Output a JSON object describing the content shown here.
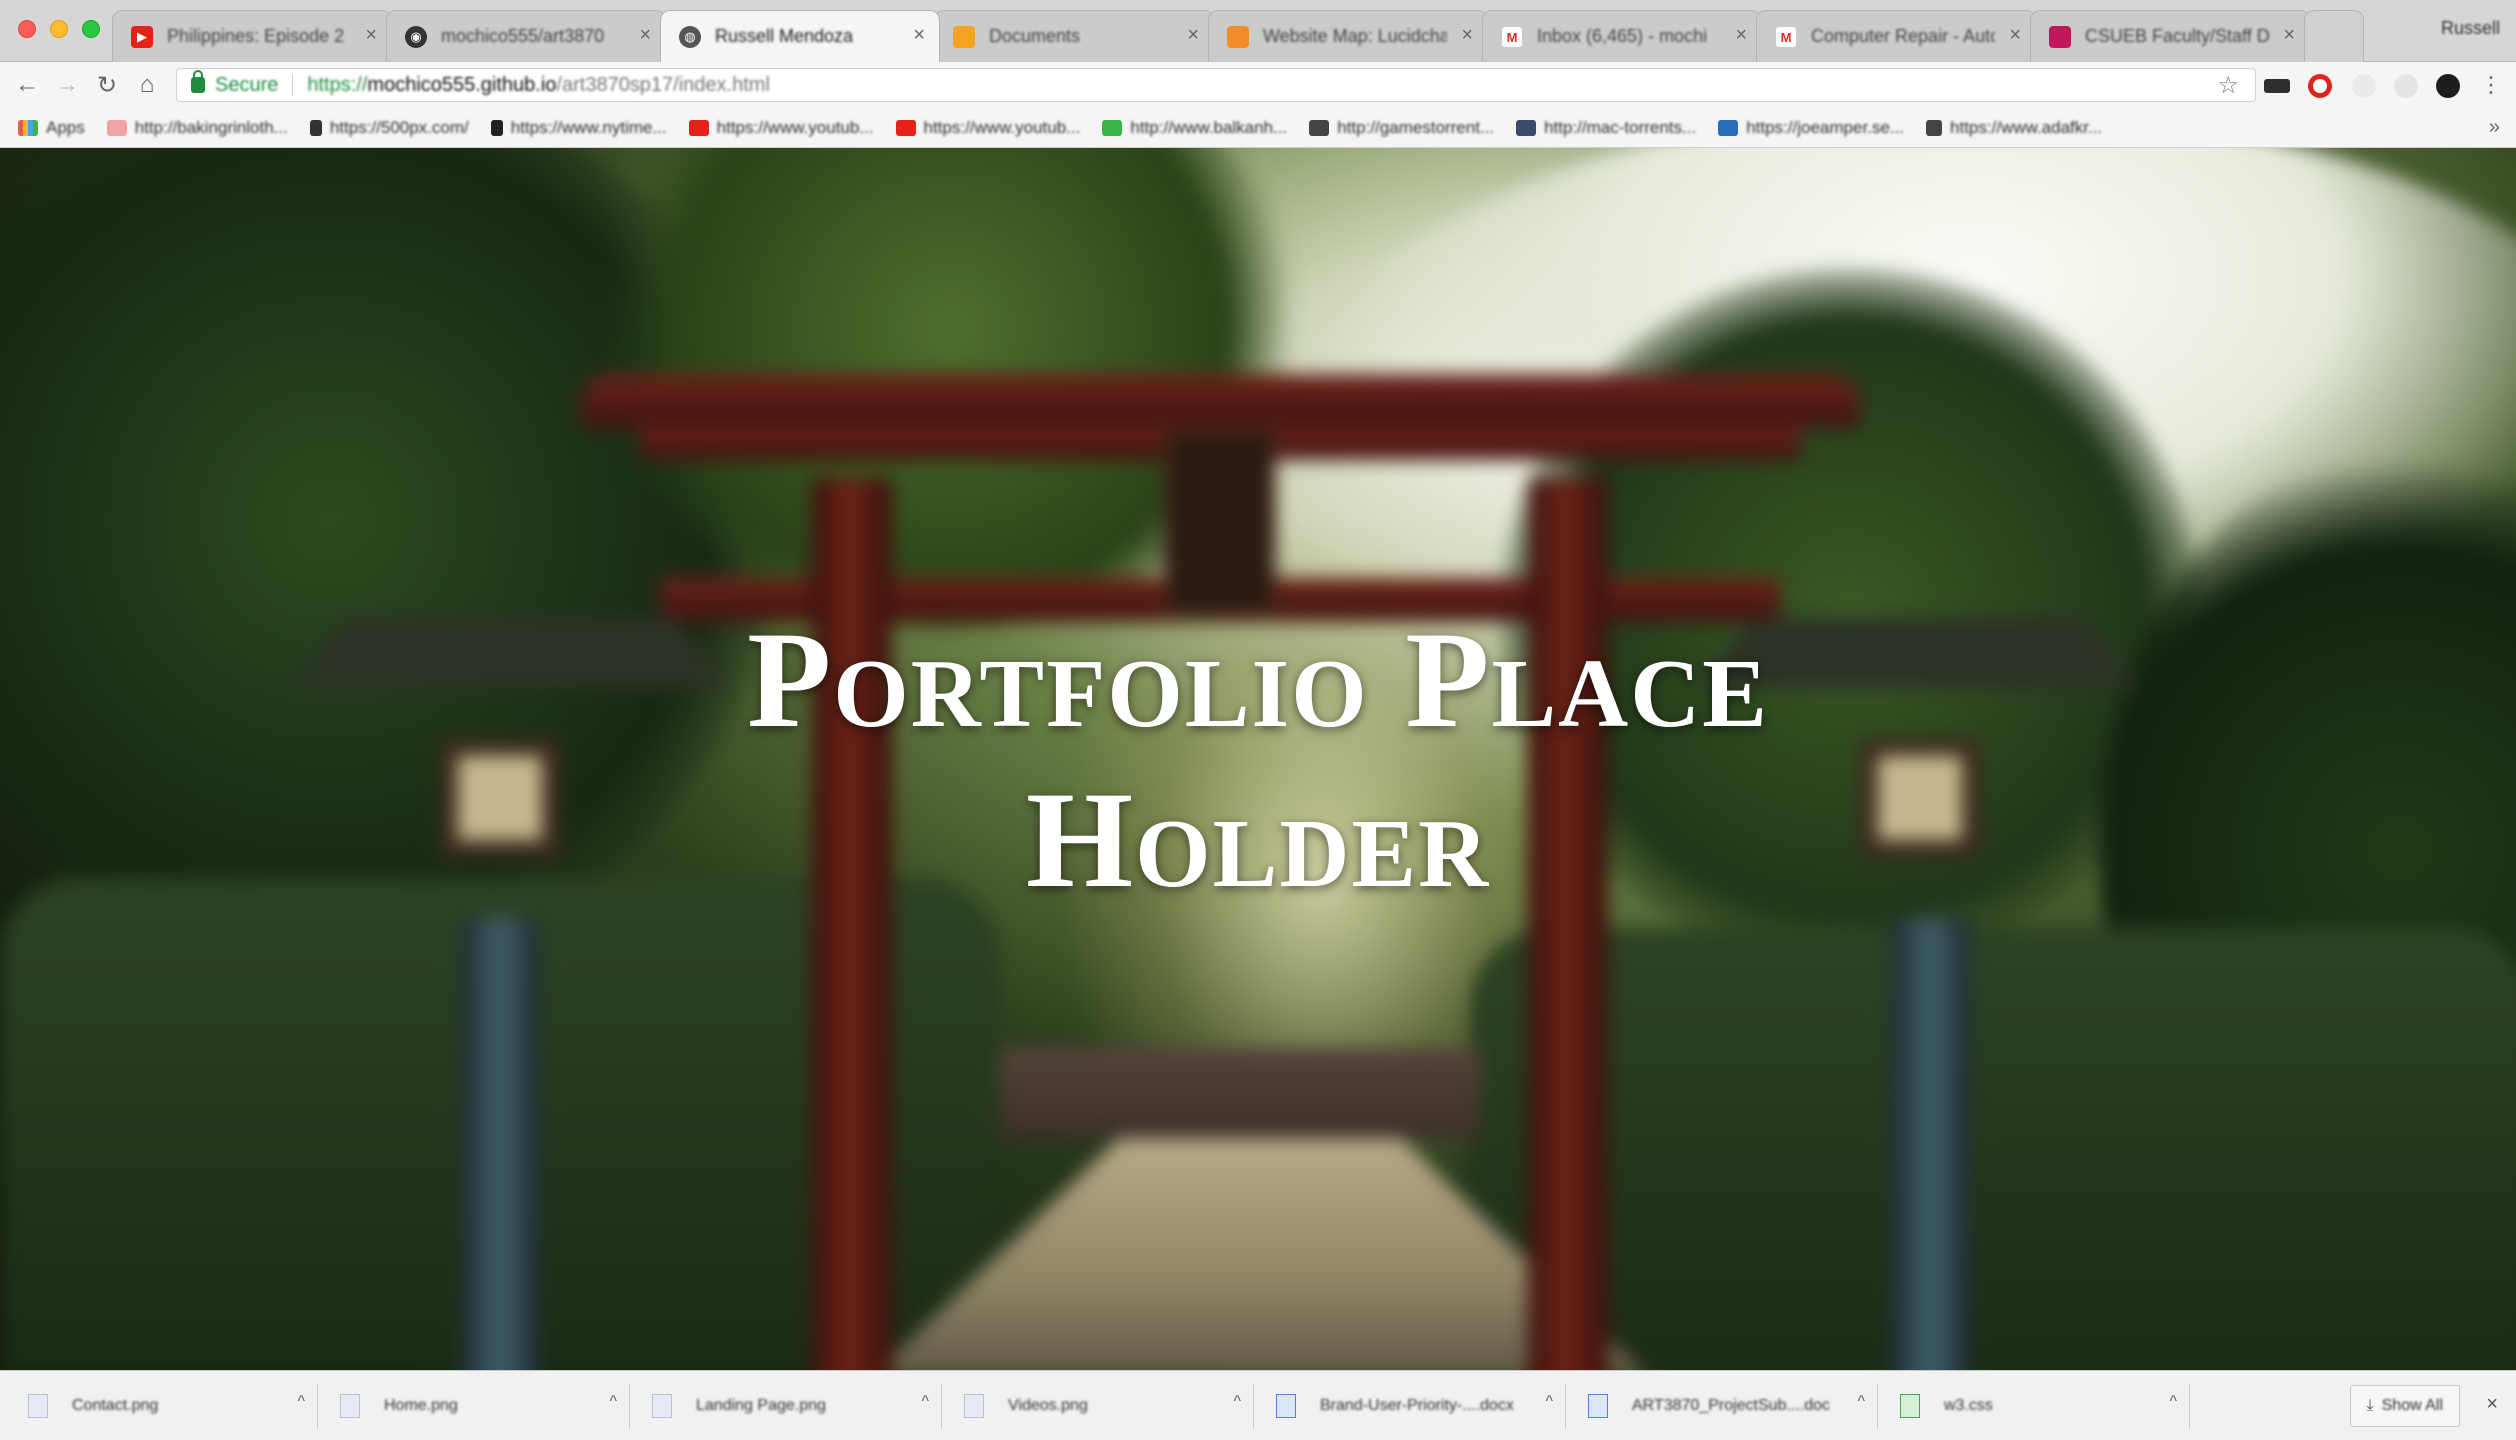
{
  "browser": {
    "tabs": [
      {
        "title": "Philippines: Episode 2",
        "favicon": "youtube-icon",
        "color": "#e62117"
      },
      {
        "title": "mochico555/art3870",
        "favicon": "github-icon",
        "color": "#333333"
      },
      {
        "title": "Russell Mendoza",
        "favicon": "globe-icon",
        "color": "#555555"
      },
      {
        "title": "Documents",
        "favicon": "folder-icon",
        "color": "#f4a320"
      },
      {
        "title": "Website Map: Lucidchart",
        "favicon": "lucidchart-icon",
        "color": "#f28c28"
      },
      {
        "title": "Inbox (6,465) - mochi",
        "favicon": "gmail-icon",
        "color": "#d93025"
      },
      {
        "title": "Computer Repair - Auto",
        "favicon": "gmail-icon",
        "color": "#d93025"
      },
      {
        "title": "CSUEB Faculty/Staff Di",
        "favicon": "csueb-icon",
        "color": "#c2185b"
      }
    ],
    "active_tab": 2,
    "profile": "Russell",
    "address": {
      "secure_label": "Secure",
      "scheme": "https://",
      "host": "mochico555.github.io",
      "path": "/art3870sp17/index.html"
    },
    "bookmarks": [
      {
        "label": "Apps",
        "color": "#e35d4f"
      },
      {
        "label": "http://bakingrinloth...",
        "color": "#f2a3a3"
      },
      {
        "label": "https://500px.com/",
        "color": "#333333"
      },
      {
        "label": "https://www.nytime...",
        "color": "#222222"
      },
      {
        "label": "https://www.youtub...",
        "color": "#e62117"
      },
      {
        "label": "https://www.youtub...",
        "color": "#e62117"
      },
      {
        "label": "http://www.balkanh...",
        "color": "#3bb54a"
      },
      {
        "label": "http://gamestorrent...",
        "color": "#444444"
      },
      {
        "label": "http://mac-torrents...",
        "color": "#3a4a6b"
      },
      {
        "label": "https://joeamper.se...",
        "color": "#2a6ebb"
      },
      {
        "label": "https://www.adafkr...",
        "color": "#444444"
      }
    ]
  },
  "page": {
    "title_line1": "Portfolio Place",
    "title_line2": "Holder"
  },
  "downloads": {
    "items": [
      {
        "name": "Contact.png",
        "type": "png"
      },
      {
        "name": "Home.png",
        "type": "png"
      },
      {
        "name": "Landing Page.png",
        "type": "png"
      },
      {
        "name": "Videos.png",
        "type": "png"
      },
      {
        "name": "Brand-User-Priority-....docx",
        "type": "docx"
      },
      {
        "name": "ART3870_ProjectSub....doc",
        "type": "docx"
      },
      {
        "name": "w3.css",
        "type": "css"
      }
    ],
    "show_all": "Show All"
  }
}
